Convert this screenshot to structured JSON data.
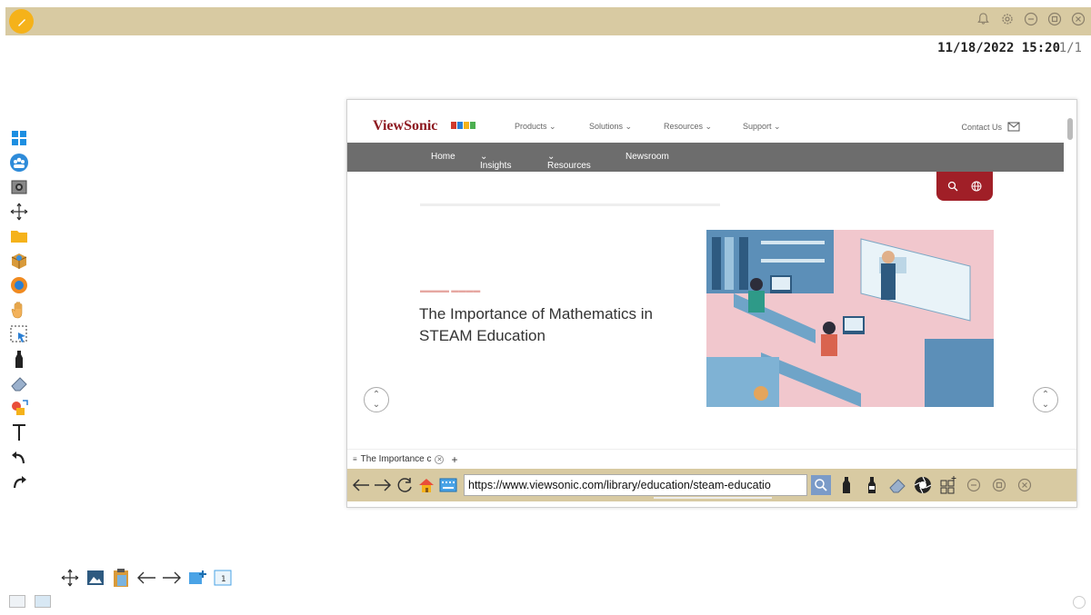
{
  "app": {
    "datetime": "11/18/2022 15:20",
    "page_indicator": "1/1",
    "accent_color": "#f5b21a",
    "bar_color": "#d8caa2"
  },
  "top_icons": [
    "bell-icon",
    "gear-icon",
    "minimize-icon",
    "restore-icon",
    "close-icon"
  ],
  "left_toolbar": [
    "windows-icon",
    "people-icon",
    "camera-icon",
    "move-icon",
    "folder-icon",
    "box-icon",
    "browser-icon",
    "hand-icon",
    "select-icon",
    "pen-icon",
    "eraser-icon",
    "shape-icon",
    "text-icon",
    "undo-icon",
    "redo-icon"
  ],
  "bottom_toolbar": [
    "move-icon",
    "image-icon",
    "clipboard-icon",
    "prev-arrow-icon",
    "next-arrow-icon",
    "add-page-icon",
    "page-icon"
  ],
  "webpage": {
    "logo": "ViewSonic",
    "menu": [
      "Products",
      "Solutions",
      "Resources",
      "Support"
    ],
    "contact": "Contact Us",
    "subnav": [
      "Home",
      "Insights",
      "Resources",
      "Newsroom"
    ],
    "article_title": "The Importance of Mathematics in STEAM Education",
    "eyebrow_color": "#e6a7a1",
    "brand_color": "#8e1b22"
  },
  "browser": {
    "tab_label": "The Importance c",
    "url": "https://www.viewsonic.com/library/education/steam-educatio"
  }
}
